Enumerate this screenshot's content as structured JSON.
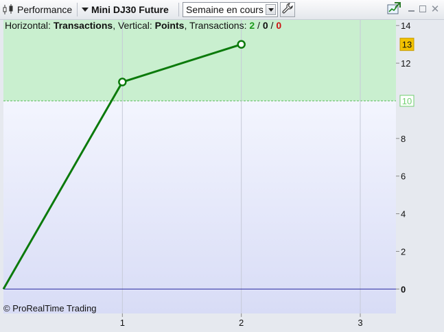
{
  "toolbar": {
    "performance_label": "Performance",
    "instrument": "Mini DJ30 Future",
    "period_select": "Semaine en cours"
  },
  "info": {
    "horizontal_label": "Horizontal: ",
    "horizontal_value": "Transactions",
    "vertical_label": ", Vertical: ",
    "vertical_value": "Points",
    "transactions_label": ", Transactions: ",
    "tx_green": "2",
    "tx_slash1": " / ",
    "tx_black": "0",
    "tx_slash2": " / ",
    "tx_red": "0"
  },
  "copyright": "© ProRealTime Trading",
  "colors": {
    "green_zone": "#c9efcf",
    "blue_zone_top": "#f3f5fe",
    "blue_zone_bottom": "#d8dcf6",
    "line": "#0b7a0b",
    "zero_line": "#2a2aa0",
    "badge_current": "#f2c200",
    "badge_level": "#6fcf6f"
  },
  "chart_data": {
    "type": "line",
    "x": [
      0,
      1,
      2
    ],
    "y": [
      0,
      11,
      13
    ],
    "xlim": [
      0,
      3.3
    ],
    "ylim": [
      -1.3,
      14.3
    ],
    "x_ticks": [
      "1",
      "2",
      "3"
    ],
    "y_ticks": [
      "0",
      "2",
      "4",
      "6",
      "8",
      "10",
      "12",
      "14"
    ],
    "current_value": "13",
    "reference_level": "10",
    "grid": "vertical"
  }
}
